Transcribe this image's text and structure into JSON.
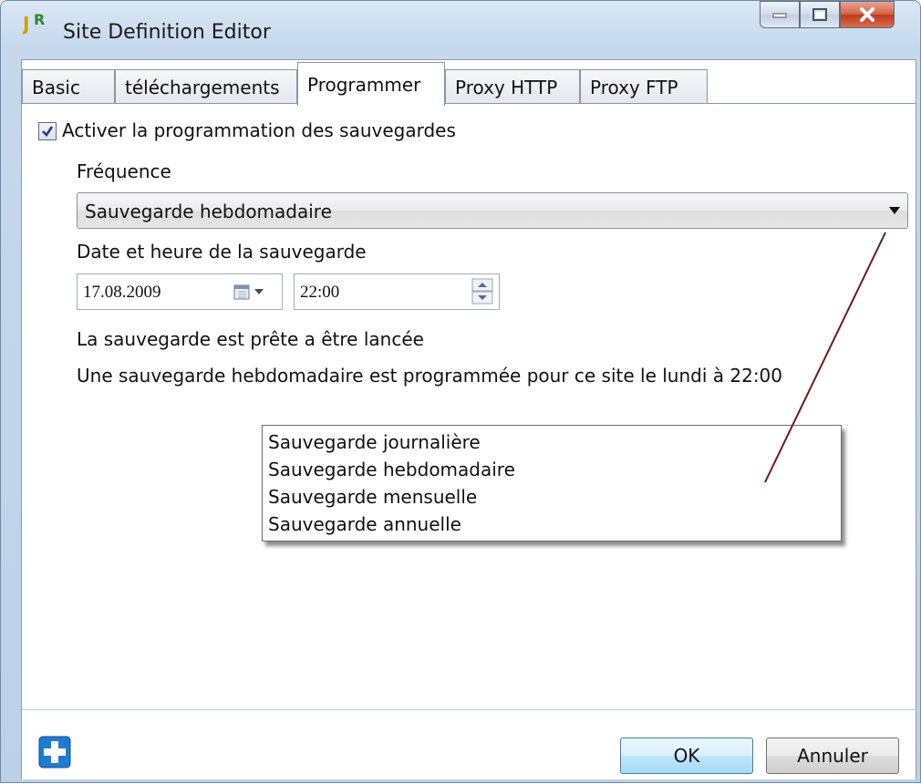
{
  "window": {
    "title": "Site Definition Editor",
    "icon_name": "app-logo-icon"
  },
  "titlebar_buttons": {
    "minimize": "minimize-icon",
    "maximize": "maximize-icon",
    "close": "close-icon"
  },
  "tabs": [
    {
      "label": "Basic"
    },
    {
      "label": "téléchargements"
    },
    {
      "label": "Programmer"
    },
    {
      "label": "Proxy HTTP"
    },
    {
      "label": "Proxy FTP"
    }
  ],
  "active_tab": "Programmer",
  "schedule": {
    "enable_label": "Activer la programmation des sauvegardes",
    "enabled": true,
    "frequency_label": "Fréquence",
    "frequency_value": "Sauvegarde hebdomadaire",
    "datetime_label": "Date et heure de la sauvegarde",
    "date_value": "17.08.2009",
    "time_value": "22:00",
    "status_text": "La sauvegarde est prête a être lancée",
    "summary_text": "Une sauvegarde hebdomadaire est programmée pour ce site le lundi à 22:00"
  },
  "dropdown_options": [
    "Sauvegarde journalière",
    "Sauvegarde hebdomadaire",
    "Sauvegarde mensuelle",
    "Sauvegarde annuelle"
  ],
  "footer": {
    "ok_label": "OK",
    "cancel_label": "Annuler",
    "add_icon": "plus-icon"
  },
  "colors": {
    "accent": "#3c7fb1",
    "close_button": "#c1381c",
    "callout_line": "#6b1a1a"
  }
}
